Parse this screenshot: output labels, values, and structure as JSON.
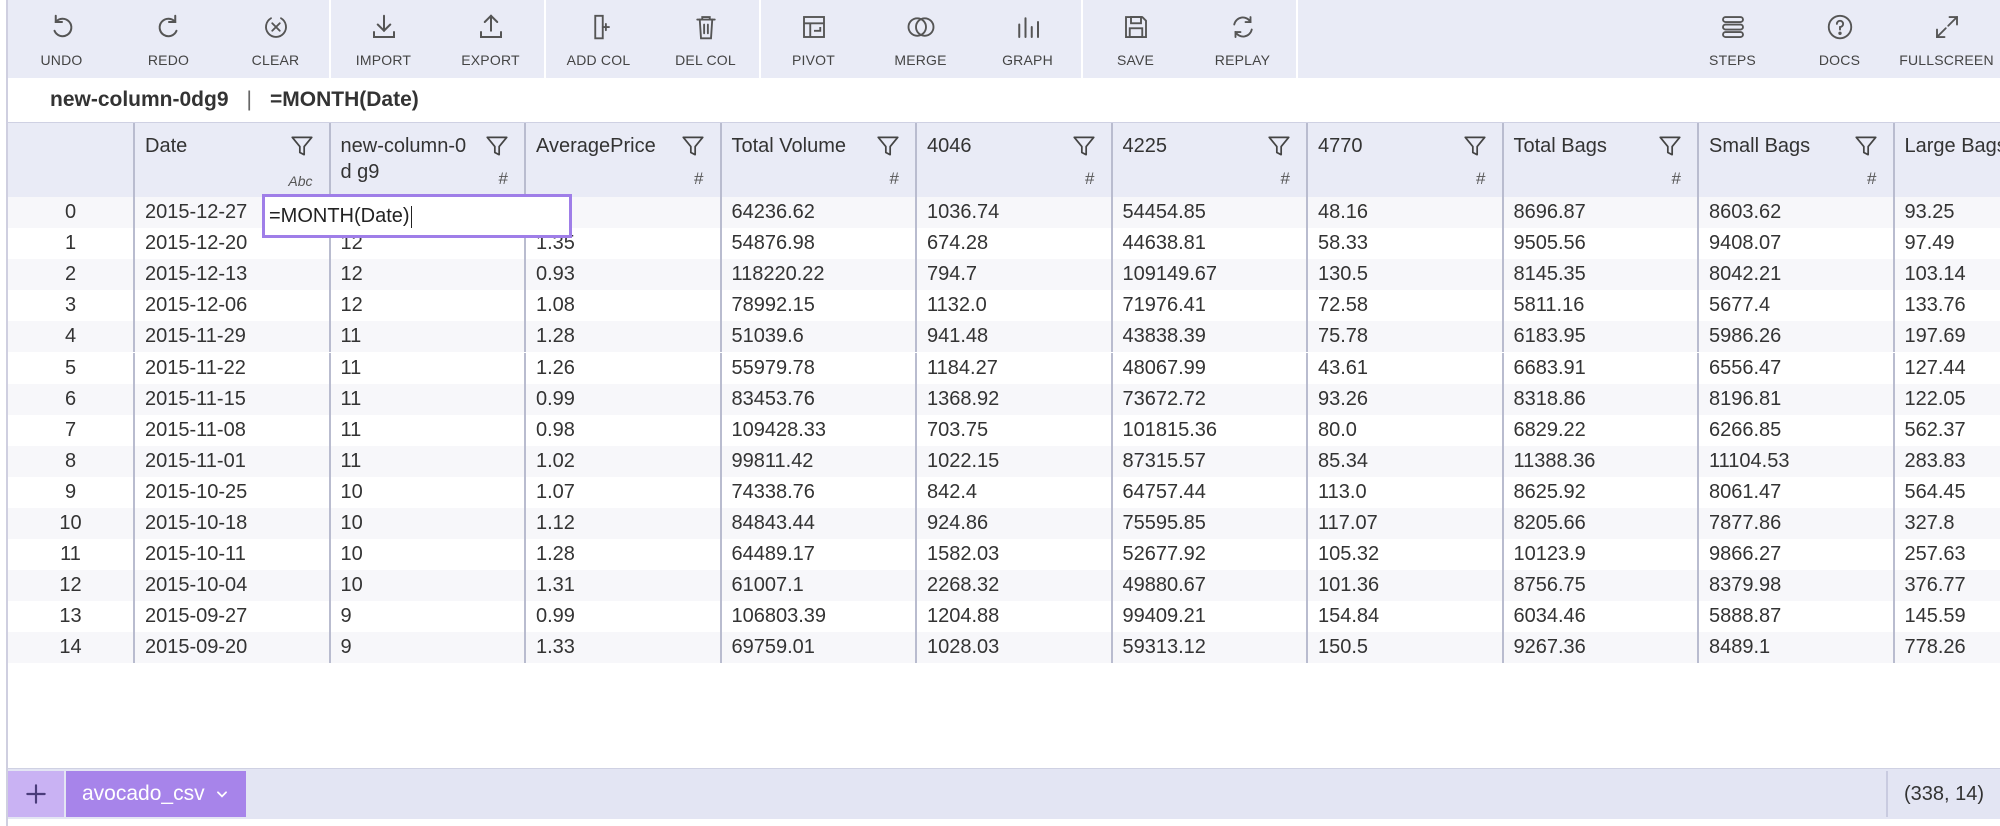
{
  "toolbar": {
    "undo": "UNDO",
    "redo": "REDO",
    "clear": "CLEAR",
    "import": "IMPORT",
    "export": "EXPORT",
    "add_col": "ADD COL",
    "del_col": "DEL COL",
    "pivot": "PIVOT",
    "merge": "MERGE",
    "graph": "GRAPH",
    "save": "SAVE",
    "replay": "REPLAY",
    "steps": "STEPS",
    "docs": "DOCS",
    "fullscreen": "FULLSCREEN"
  },
  "formula_bar": {
    "column_name": "new-column-0dg9",
    "separator": "|",
    "formula": "=MONTH(Date)"
  },
  "columns": [
    {
      "name": "Date",
      "type": "Abc"
    },
    {
      "name": "new-column-0d g9",
      "type": "#"
    },
    {
      "name": "AveragePrice",
      "type": "#"
    },
    {
      "name": "Total Volume",
      "type": "#"
    },
    {
      "name": "4046",
      "type": "#"
    },
    {
      "name": "4225",
      "type": "#"
    },
    {
      "name": "4770",
      "type": "#"
    },
    {
      "name": "Total Bags",
      "type": "#"
    },
    {
      "name": "Small Bags",
      "type": "#"
    },
    {
      "name": "Large Bags",
      "type": ""
    }
  ],
  "rows": [
    [
      "0",
      "2015-12-27",
      "",
      "",
      "64236.62",
      "1036.74",
      "54454.85",
      "48.16",
      "8696.87",
      "8603.62",
      "93.25"
    ],
    [
      "1",
      "2015-12-20",
      "12",
      "1.35",
      "54876.98",
      "674.28",
      "44638.81",
      "58.33",
      "9505.56",
      "9408.07",
      "97.49"
    ],
    [
      "2",
      "2015-12-13",
      "12",
      "0.93",
      "118220.22",
      "794.7",
      "109149.67",
      "130.5",
      "8145.35",
      "8042.21",
      "103.14"
    ],
    [
      "3",
      "2015-12-06",
      "12",
      "1.08",
      "78992.15",
      "1132.0",
      "71976.41",
      "72.58",
      "5811.16",
      "5677.4",
      "133.76"
    ],
    [
      "4",
      "2015-11-29",
      "11",
      "1.28",
      "51039.6",
      "941.48",
      "43838.39",
      "75.78",
      "6183.95",
      "5986.26",
      "197.69"
    ],
    [
      "5",
      "2015-11-22",
      "11",
      "1.26",
      "55979.78",
      "1184.27",
      "48067.99",
      "43.61",
      "6683.91",
      "6556.47",
      "127.44"
    ],
    [
      "6",
      "2015-11-15",
      "11",
      "0.99",
      "83453.76",
      "1368.92",
      "73672.72",
      "93.26",
      "8318.86",
      "8196.81",
      "122.05"
    ],
    [
      "7",
      "2015-11-08",
      "11",
      "0.98",
      "109428.33",
      "703.75",
      "101815.36",
      "80.0",
      "6829.22",
      "6266.85",
      "562.37"
    ],
    [
      "8",
      "2015-11-01",
      "11",
      "1.02",
      "99811.42",
      "1022.15",
      "87315.57",
      "85.34",
      "11388.36",
      "11104.53",
      "283.83"
    ],
    [
      "9",
      "2015-10-25",
      "10",
      "1.07",
      "74338.76",
      "842.4",
      "64757.44",
      "113.0",
      "8625.92",
      "8061.47",
      "564.45"
    ],
    [
      "10",
      "2015-10-18",
      "10",
      "1.12",
      "84843.44",
      "924.86",
      "75595.85",
      "117.07",
      "8205.66",
      "7877.86",
      "327.8"
    ],
    [
      "11",
      "2015-10-11",
      "10",
      "1.28",
      "64489.17",
      "1582.03",
      "52677.92",
      "105.32",
      "10123.9",
      "9866.27",
      "257.63"
    ],
    [
      "12",
      "2015-10-04",
      "10",
      "1.31",
      "61007.1",
      "2268.32",
      "49880.67",
      "101.36",
      "8756.75",
      "8379.98",
      "376.77"
    ],
    [
      "13",
      "2015-09-27",
      "9",
      "0.99",
      "106803.39",
      "1204.88",
      "99409.21",
      "154.84",
      "6034.46",
      "5888.87",
      "145.59"
    ],
    [
      "14",
      "2015-09-20",
      "9",
      "1.33",
      "69759.01",
      "1028.03",
      "59313.12",
      "150.5",
      "9267.36",
      "8489.1",
      "778.26"
    ]
  ],
  "editor": {
    "value": "=MONTH(Date)"
  },
  "footer": {
    "sheet_name": "avocado_csv",
    "dimensions": "(338, 14)"
  },
  "colors": {
    "toolbar_bg": "#e9ebf6",
    "accent": "#a784ea",
    "accent_light": "#c9b2f3",
    "editor_border": "#9f7ee8"
  }
}
